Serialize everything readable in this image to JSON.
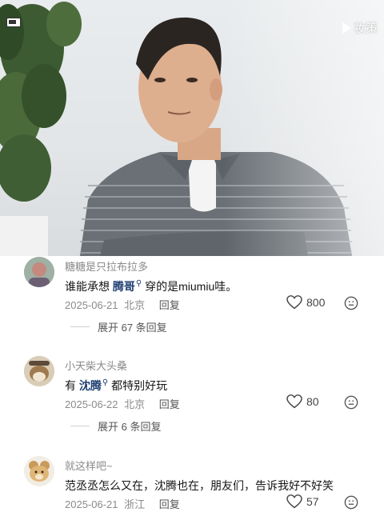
{
  "video": {
    "watermark_text": "妆策"
  },
  "comments": [
    {
      "username": "糖糖是只拉布拉多",
      "text_before": "谁能承想",
      "mention": "腾哥",
      "text_after": "穿的是miumiu哇。",
      "date": "2025-06-21",
      "location": "北京",
      "reply_label": "回复",
      "likes": "800",
      "expand_label": "展开 67 条回复"
    },
    {
      "username": "小天柴大头桑",
      "text_before": "有",
      "mention": "沈腾",
      "text_after": "都特别好玩",
      "date": "2025-06-22",
      "location": "北京",
      "reply_label": "回复",
      "likes": "80",
      "expand_label": "展开 6 条回复"
    },
    {
      "username": "就这样吧~",
      "text_before": "范丞丞怎么又在，沈腾也在，朋友们，告诉我好不好笑",
      "mention": "",
      "text_after": "",
      "date": "2025-06-21",
      "location": "浙江",
      "reply_label": "回复",
      "likes": "57",
      "expand_label": ""
    }
  ],
  "icons": {
    "like": "heart-outline-icon",
    "emoji": "emoji-face-icon",
    "mention": "search-link-icon"
  }
}
